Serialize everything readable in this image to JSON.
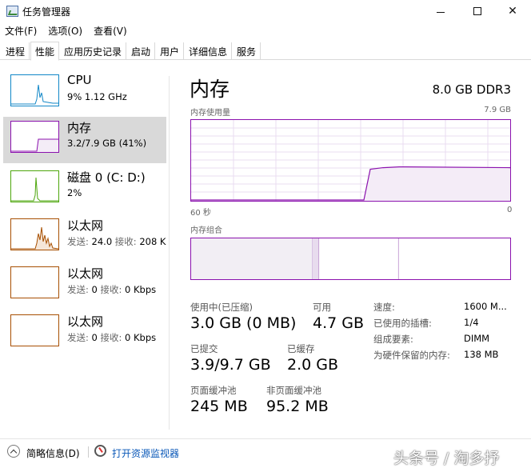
{
  "window": {
    "title": "任务管理器",
    "minimize": "—",
    "close": "✕"
  },
  "menu": [
    {
      "label": "文件(F)"
    },
    {
      "label": "选项(O)"
    },
    {
      "label": "查看(V)"
    }
  ],
  "tabs": [
    {
      "label": "进程"
    },
    {
      "label": "性能",
      "active": true
    },
    {
      "label": "应用历史记录"
    },
    {
      "label": "启动"
    },
    {
      "label": "用户"
    },
    {
      "label": "详细信息"
    },
    {
      "label": "服务"
    }
  ],
  "resources": [
    {
      "name": "CPU",
      "detail": "9% 1.12 GHz",
      "color": "#1187c7"
    },
    {
      "name": "内存",
      "detail": "3.2/7.9 GB (41%)",
      "color": "#8b12ae"
    },
    {
      "name": "磁盘 0 (C: D:)",
      "detail": "2%",
      "color": "#4da60c"
    },
    {
      "name": "以太网",
      "detail_send_label": "发送:",
      "detail_send": "24.0",
      "detail_recv_label": "接收:",
      "detail_recv": "208 K",
      "color": "#a74f01"
    },
    {
      "name": "以太网",
      "detail_send_label": "发送:",
      "detail_send": "0",
      "detail_recv_label": "接收:",
      "detail_recv": "0 Kbps",
      "color": "#a74f01"
    },
    {
      "name": "以太网",
      "detail_send_label": "发送:",
      "detail_send": "0",
      "detail_recv_label": "接收:",
      "detail_recv": "0 Kbps",
      "color": "#a74f01"
    }
  ],
  "main": {
    "title": "内存",
    "spec": "8.0 GB DDR3",
    "usage_graph": {
      "label": "内存使用量",
      "max": "7.9 GB",
      "x_left": "60 秒",
      "x_right": "0",
      "usage_fraction_recent": 0.41
    },
    "composition_graph": {
      "label": "内存组合",
      "in_use_fraction": 0.38,
      "modified_fraction": 0.02,
      "standby_fraction": 0.25
    },
    "stats": {
      "in_use_label": "使用中(已压缩)",
      "in_use_value": "3.0 GB (0 MB)",
      "available_label": "可用",
      "available_value": "4.7 GB",
      "committed_label": "已提交",
      "committed_value": "3.9/9.7 GB",
      "cached_label": "已缓存",
      "cached_value": "2.0 GB",
      "paged_label": "页面缓冲池",
      "paged_value": "245 MB",
      "nonpaged_label": "非页面缓冲池",
      "nonpaged_value": "95.2 MB"
    },
    "details": [
      {
        "label": "速度:",
        "value": "1600 M..."
      },
      {
        "label": "已使用的插槽:",
        "value": "1/4"
      },
      {
        "label": "组成要素:",
        "value": "DIMM"
      },
      {
        "label": "为硬件保留的内存:",
        "value": "138 MB"
      }
    ]
  },
  "footer": {
    "fewer_details": "简略信息(D)",
    "open_monitor": "打开资源监视器"
  },
  "watermark": "头条号 / 淘多抒",
  "colors": {
    "memory": "#8b12ae",
    "cpu": "#1187c7",
    "disk": "#4da60c",
    "ethernet": "#a74f01",
    "selected": "#d9d9d9"
  }
}
